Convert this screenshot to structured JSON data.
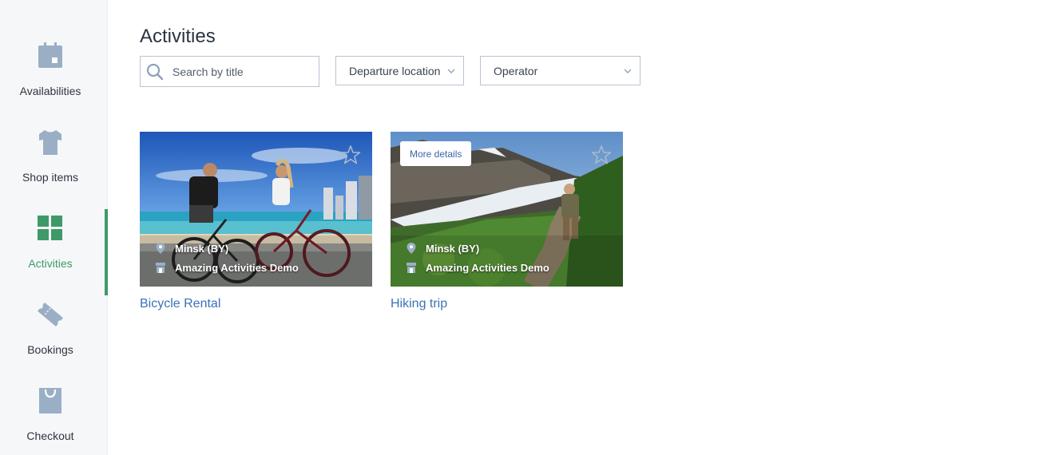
{
  "sidebar": {
    "items": [
      {
        "label": "Availabilities",
        "icon": "calendar-icon"
      },
      {
        "label": "Shop items",
        "icon": "tshirt-icon"
      },
      {
        "label": "Activities",
        "icon": "grid-icon",
        "active": true
      },
      {
        "label": "Bookings",
        "icon": "ticket-icon"
      },
      {
        "label": "Checkout",
        "icon": "shopping-bag-icon"
      }
    ]
  },
  "main": {
    "title": "Activities",
    "search": {
      "placeholder": "Search by title",
      "value": ""
    },
    "filters": {
      "departure": "Departure location",
      "operator": "Operator"
    }
  },
  "cards": [
    {
      "title": "Bicycle Rental",
      "location": "Minsk (BY)",
      "operator": "Amazing Activities Demo"
    },
    {
      "title": "Hiking trip",
      "location": "Minsk (BY)",
      "operator": "Amazing Activities Demo",
      "more_details": "More details"
    }
  ],
  "colors": {
    "accent": "#3e9a68",
    "link": "#3a72b8",
    "icon_muted": "#9aafc6"
  }
}
